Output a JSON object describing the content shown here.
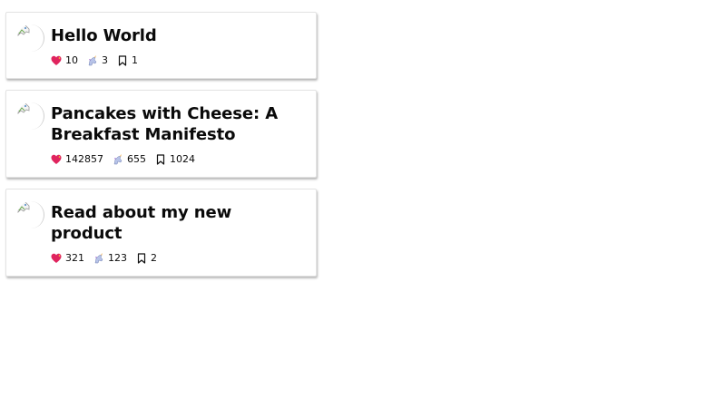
{
  "posts": [
    {
      "avatar_icon": "broken-image-icon",
      "title": "Hello World",
      "reactions": {
        "icon": "sparkling-heart-icon",
        "count": "10"
      },
      "unicorns": {
        "icon": "unicorn-icon",
        "count": "3"
      },
      "saves": {
        "icon": "bookmark-icon",
        "count": "1"
      }
    },
    {
      "avatar_icon": "broken-image-icon",
      "title": "Pancakes with Cheese: A Breakfast Manifesto",
      "reactions": {
        "icon": "sparkling-heart-icon",
        "count": "142857"
      },
      "unicorns": {
        "icon": "unicorn-icon",
        "count": "655"
      },
      "saves": {
        "icon": "bookmark-icon",
        "count": "1024"
      }
    },
    {
      "avatar_icon": "broken-image-icon",
      "title": "Read about my new product",
      "reactions": {
        "icon": "sparkling-heart-icon",
        "count": "321"
      },
      "unicorns": {
        "icon": "unicorn-icon",
        "count": "123"
      },
      "saves": {
        "icon": "bookmark-icon",
        "count": "2"
      }
    }
  ]
}
